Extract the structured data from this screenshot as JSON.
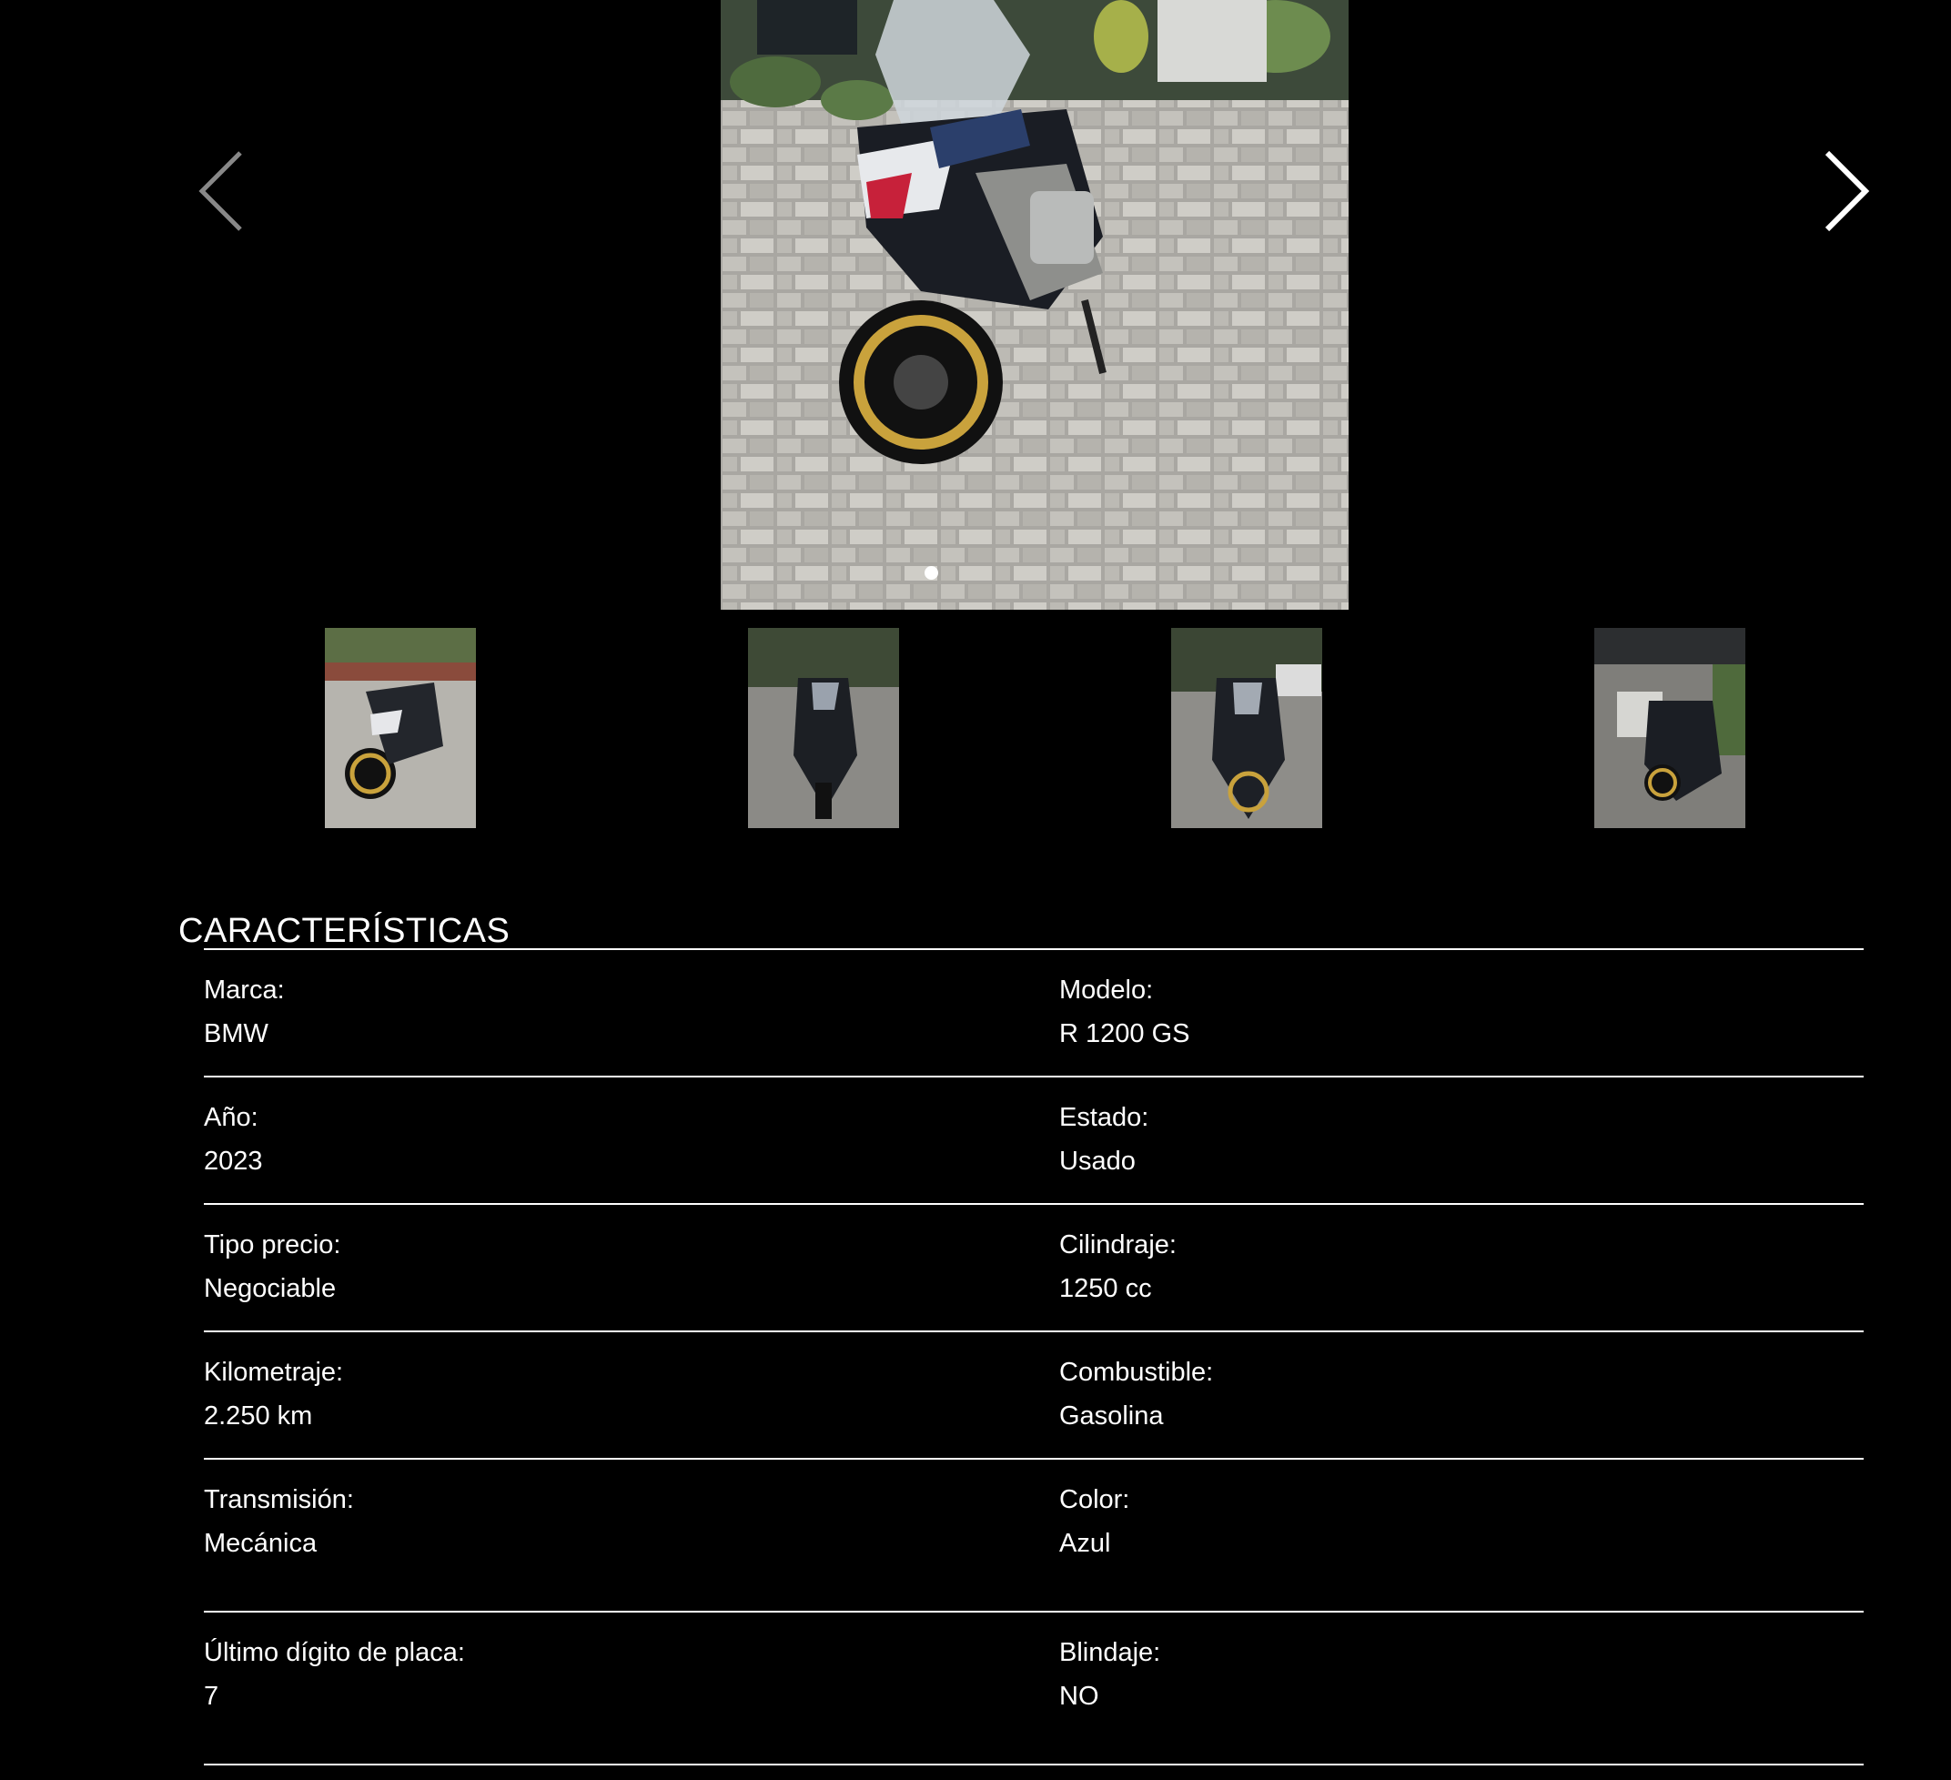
{
  "gallery": {
    "prev_icon": "chevron-left-icon",
    "next_icon": "chevron-right-icon",
    "thumbnails": [
      {
        "name": "thumbnail-1"
      },
      {
        "name": "thumbnail-2"
      },
      {
        "name": "thumbnail-3"
      },
      {
        "name": "thumbnail-4"
      }
    ]
  },
  "section": {
    "title": "CARACTERÍSTICAS"
  },
  "specs": [
    {
      "left": {
        "label": "Marca:",
        "value": "BMW"
      },
      "right": {
        "label": "Modelo:",
        "value": "R 1200 GS"
      }
    },
    {
      "left": {
        "label": "Año:",
        "value": "2023"
      },
      "right": {
        "label": "Estado:",
        "value": "Usado"
      }
    },
    {
      "left": {
        "label": "Tipo precio:",
        "value": "Negociable"
      },
      "right": {
        "label": "Cilindraje:",
        "value": "1250 cc"
      }
    },
    {
      "left": {
        "label": "Kilometraje:",
        "value": "2.250 km"
      },
      "right": {
        "label": "Combustible:",
        "value": "Gasolina"
      }
    },
    {
      "left": {
        "label": "Transmisión:",
        "value": "Mecánica"
      },
      "right": {
        "label": "Color:",
        "value": "Azul"
      }
    },
    {
      "left": {
        "label": "Último dígito de placa:",
        "value": "7"
      },
      "right": {
        "label": "Blindaje:",
        "value": "NO"
      }
    }
  ]
}
